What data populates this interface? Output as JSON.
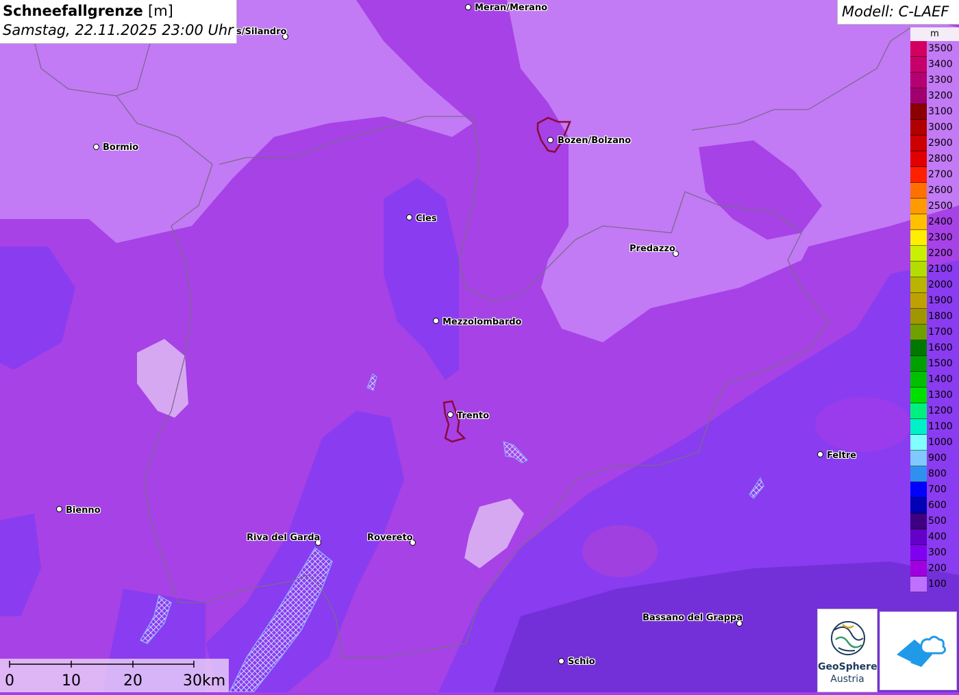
{
  "title": {
    "parameter": "Schneefallgrenze",
    "unit": "[m]",
    "datetime": "Samstag, 22.11.2025 23:00 Uhr"
  },
  "model": "Modell: C-LAEF",
  "legend": {
    "unit": "m",
    "levels": [
      {
        "label": "3500",
        "color": "#d4005f"
      },
      {
        "label": "3400",
        "color": "#c8006a"
      },
      {
        "label": "3300",
        "color": "#b40070"
      },
      {
        "label": "3200",
        "color": "#a0006e"
      },
      {
        "label": "3100",
        "color": "#8b0000"
      },
      {
        "label": "3000",
        "color": "#b00000"
      },
      {
        "label": "2900",
        "color": "#cc0000"
      },
      {
        "label": "2800",
        "color": "#e00000"
      },
      {
        "label": "2700",
        "color": "#ff2000"
      },
      {
        "label": "2600",
        "color": "#ff7000"
      },
      {
        "label": "2500",
        "color": "#ff9a00"
      },
      {
        "label": "2400",
        "color": "#ffc000"
      },
      {
        "label": "2300",
        "color": "#ffee00"
      },
      {
        "label": "2200",
        "color": "#c8f000"
      },
      {
        "label": "2100",
        "color": "#b4dc00"
      },
      {
        "label": "2000",
        "color": "#b8b400"
      },
      {
        "label": "1900",
        "color": "#c0a000"
      },
      {
        "label": "1800",
        "color": "#a09600"
      },
      {
        "label": "1700",
        "color": "#6ea000"
      },
      {
        "label": "1600",
        "color": "#007800"
      },
      {
        "label": "1500",
        "color": "#00a000"
      },
      {
        "label": "1400",
        "color": "#00c000"
      },
      {
        "label": "1300",
        "color": "#00e000"
      },
      {
        "label": "1200",
        "color": "#00f080"
      },
      {
        "label": "1100",
        "color": "#00f0c8"
      },
      {
        "label": "1000",
        "color": "#80ffff"
      },
      {
        "label": "900",
        "color": "#80c8ff"
      },
      {
        "label": "800",
        "color": "#3090f0"
      },
      {
        "label": "700",
        "color": "#0000ff"
      },
      {
        "label": "600",
        "color": "#0000b4"
      },
      {
        "label": "500",
        "color": "#3c0080"
      },
      {
        "label": "400",
        "color": "#6400c8"
      },
      {
        "label": "300",
        "color": "#8000f0"
      },
      {
        "label": "200",
        "color": "#a000e0"
      },
      {
        "label": "100",
        "color": "#c070ff"
      }
    ]
  },
  "places": [
    {
      "id": "meran",
      "name": "Meran/Merano"
    },
    {
      "id": "silandro",
      "name": "s/Silandro"
    },
    {
      "id": "bormio",
      "name": "Bormio"
    },
    {
      "id": "bozen",
      "name": "Bozen/Bolzano"
    },
    {
      "id": "cles",
      "name": "Cles"
    },
    {
      "id": "predazzo",
      "name": "Predazzo"
    },
    {
      "id": "mezzolombardo",
      "name": "Mezzolombardo"
    },
    {
      "id": "trento",
      "name": "Trento"
    },
    {
      "id": "feltre",
      "name": "Feltre"
    },
    {
      "id": "bienno",
      "name": "Bienno"
    },
    {
      "id": "riva",
      "name": "Riva del Garda"
    },
    {
      "id": "rovereto",
      "name": "Rovereto"
    },
    {
      "id": "bassano",
      "name": "Bassano del Grappa"
    },
    {
      "id": "schio",
      "name": "Schio"
    }
  ],
  "scale": {
    "labels": [
      "0",
      "10",
      "20",
      "30km"
    ]
  },
  "logos": {
    "geosphere_name": "GeoSphere",
    "geosphere_sub": "Austria",
    "icon_name": "cloud-house-icon"
  }
}
